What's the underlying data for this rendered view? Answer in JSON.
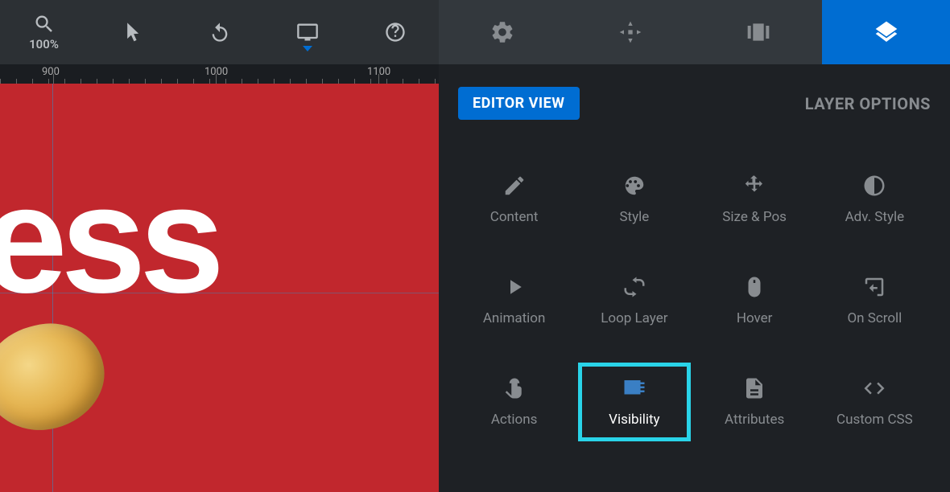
{
  "toolbar": {
    "zoom_label": "100%"
  },
  "ruler": {
    "marks": [
      "900",
      "1000",
      "1100"
    ]
  },
  "canvas": {
    "text": "ness"
  },
  "panel": {
    "editor_view": "EDITOR VIEW",
    "layer_options": "LAYER OPTIONS",
    "options": [
      {
        "label": "Content",
        "icon": "pencil"
      },
      {
        "label": "Style",
        "icon": "palette"
      },
      {
        "label": "Size & Pos",
        "icon": "move"
      },
      {
        "label": "Adv. Style",
        "icon": "contrast"
      },
      {
        "label": "Animation",
        "icon": "play"
      },
      {
        "label": "Loop Layer",
        "icon": "loop"
      },
      {
        "label": "Hover",
        "icon": "mouse"
      },
      {
        "label": "On Scroll",
        "icon": "scroll"
      },
      {
        "label": "Actions",
        "icon": "touch"
      },
      {
        "label": "Visibility",
        "icon": "visibility",
        "selected": true
      },
      {
        "label": "Attributes",
        "icon": "file"
      },
      {
        "label": "Custom CSS",
        "icon": "code"
      }
    ]
  }
}
